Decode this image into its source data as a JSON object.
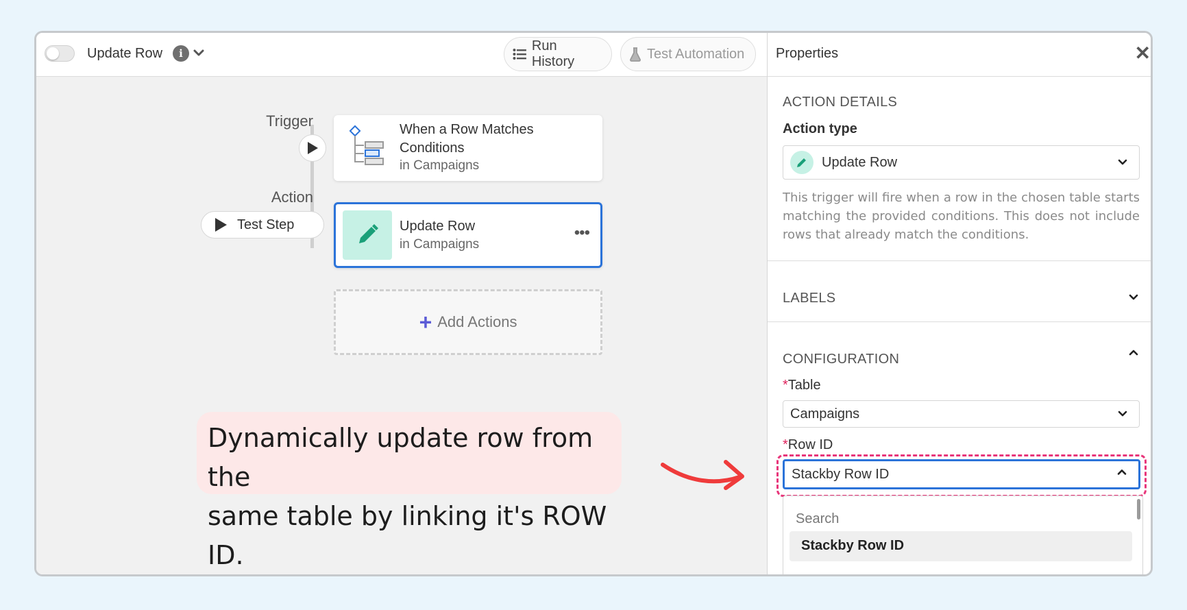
{
  "topbar": {
    "automation_name": "Update Row",
    "run_history_label": "Run History",
    "test_automation_label": "Test Automation"
  },
  "flow": {
    "trigger_label": "Trigger",
    "action_label": "Action",
    "test_step_label": "Test Step",
    "trigger_card": {
      "title_line1": "When a Row Matches",
      "title_line2": "Conditions",
      "subtitle": "in Campaigns"
    },
    "action_card": {
      "title": "Update Row",
      "subtitle": "in Campaigns",
      "more": "•••"
    },
    "add_actions_label": "Add Actions"
  },
  "callout": {
    "line1": "Dynamically update row from the",
    "line2": "same table by linking it's ROW ID."
  },
  "properties": {
    "title": "Properties",
    "close": "✕",
    "action_details_heading": "ACTION DETAILS",
    "action_type_label": "Action type",
    "action_type_value": "Update Row",
    "description": "This trigger will fire when a row in the chosen table starts matching the provided conditions. This does not include rows that already match the conditions.",
    "labels_heading": "LABELS",
    "configuration_heading": "CONFIGURATION",
    "table_label": "Table",
    "table_value": "Campaigns",
    "row_id_label": "Row ID",
    "row_id_value": "Stackby Row ID",
    "required_mark": "*",
    "dropdown": {
      "search_placeholder": "Search",
      "options": [
        "Stackby Row ID"
      ]
    }
  },
  "colors": {
    "accent_blue": "#2b73d9",
    "highlight_pink": "#e8357a",
    "pencil_bg": "#c6f1e5",
    "callout_bg": "#fde8e8",
    "arrow_red": "#ef3b3b"
  }
}
